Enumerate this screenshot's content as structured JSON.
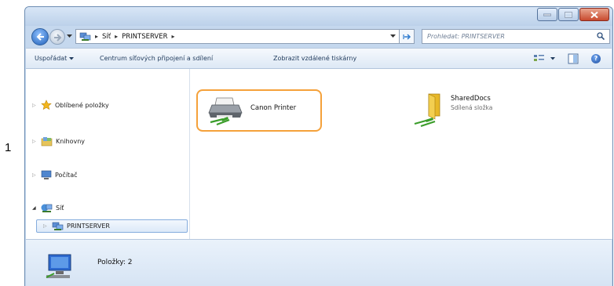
{
  "step_number": "1",
  "address": {
    "crumbs": [
      "Síť",
      "PRINTSERVER"
    ]
  },
  "search": {
    "placeholder": "Prohledat: PRINTSERVER"
  },
  "toolbar": {
    "organize": "Uspořádat",
    "network_center": "Centrum síťových připojení a sdílení",
    "remote_printers": "Zobrazit vzdálené tiskárny"
  },
  "sidebar": {
    "favorites": "Oblíbené položky",
    "libraries": "Knihovny",
    "computer": "Počítač",
    "network": "Síť",
    "printserver": "PRINTSERVER"
  },
  "items": [
    {
      "name": "Canon Printer",
      "icon": "network-printer-icon",
      "highlighted": true
    },
    {
      "name": "SharedDocs",
      "subtitle": "Sdílená složka",
      "icon": "shared-folder-icon"
    }
  ],
  "status": {
    "count": "Položky: 2"
  },
  "colors": {
    "highlight": "#f5a13a",
    "window_frame": "#c5d8ee",
    "link_text": "#1e395b"
  }
}
